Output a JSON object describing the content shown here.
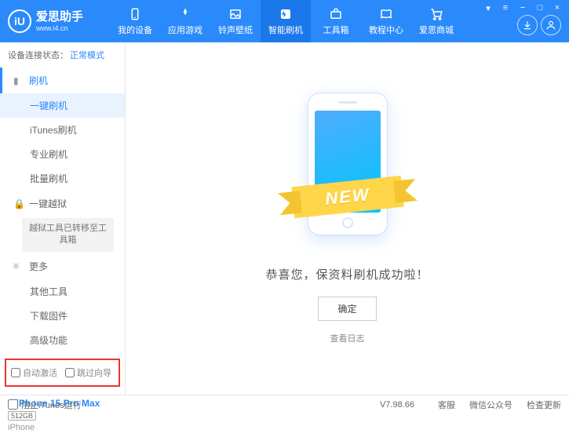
{
  "logo": {
    "icon": "iU",
    "title": "爱思助手",
    "subtitle": "www.i4.cn"
  },
  "nav": [
    {
      "label": "我的设备"
    },
    {
      "label": "应用游戏"
    },
    {
      "label": "铃声壁纸"
    },
    {
      "label": "智能刷机"
    },
    {
      "label": "工具箱"
    },
    {
      "label": "教程中心"
    },
    {
      "label": "爱思商城"
    }
  ],
  "status": {
    "label": "设备连接状态：",
    "value": "正常模式"
  },
  "sidebar": {
    "sec1": {
      "title": "刷机",
      "items": [
        "一键刷机",
        "iTunes刷机",
        "专业刷机",
        "批量刷机"
      ]
    },
    "sec2": {
      "title": "一键越狱",
      "boxed": "越狱工具已转移至工具箱"
    },
    "sec3": {
      "title": "更多",
      "items": [
        "其他工具",
        "下载固件",
        "高级功能"
      ]
    }
  },
  "options": {
    "auto_activate": "自动激活",
    "skip_setup": "跳过向导"
  },
  "device": {
    "name": "iPhone 15 Pro Max",
    "storage": "512GB",
    "type": "iPhone"
  },
  "main": {
    "ribbon": "NEW",
    "success": "恭喜您，保资料刷机成功啦！",
    "ok": "确定",
    "log": "查看日志"
  },
  "footer": {
    "block_itunes": "阻止iTunes运行",
    "version": "V7.98.66",
    "links": [
      "客服",
      "微信公众号",
      "检查更新"
    ]
  }
}
